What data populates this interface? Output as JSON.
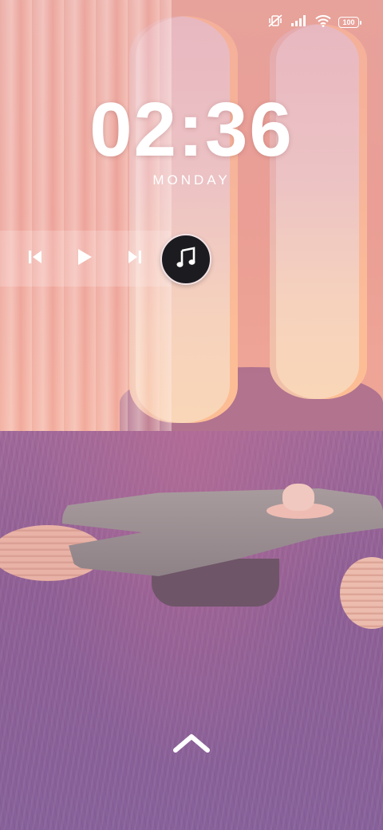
{
  "status_bar": {
    "icons": [
      "mute-vibrate-icon",
      "cellular-signal-icon",
      "wifi-icon",
      "battery-icon"
    ],
    "battery_level": "100"
  },
  "lock_screen": {
    "time": "02:36",
    "day": "MONDAY"
  },
  "media_controls": {
    "buttons": [
      "previous-track-icon",
      "play-icon",
      "next-track-icon"
    ],
    "album_art_icon": "music-note-icon"
  },
  "unlock": {
    "icon": "chevron-up-icon"
  },
  "colors": {
    "text": "#ffffff",
    "wall": "#e7a29b",
    "lawn": "#8e5f95"
  }
}
